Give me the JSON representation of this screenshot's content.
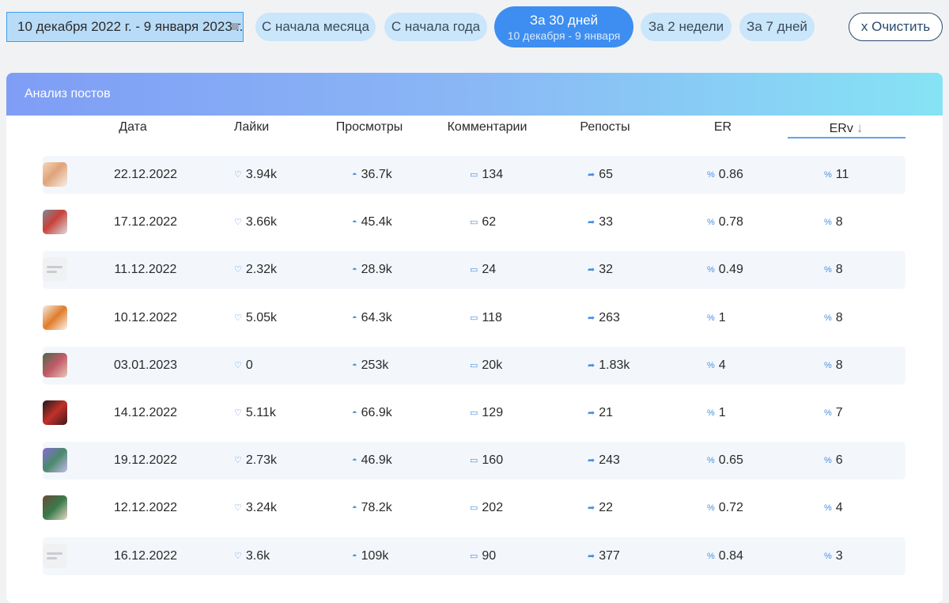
{
  "filters": {
    "date_range": "10 декабря 2022 г. - 9 января 2023 г.",
    "from_month_start": "С начала месяца",
    "from_year_start": "С начала года",
    "last_30_days": "За 30 дней",
    "last_30_days_range": "10 декабря - 9 января",
    "last_2_weeks": "За 2 недели",
    "last_7_days": "За 7 дней",
    "clear": "x Очистить"
  },
  "panel": {
    "title": "Анализ постов"
  },
  "columns": {
    "date": "Дата",
    "likes": "Лайки",
    "views": "Просмотры",
    "comments": "Комментарии",
    "reposts": "Репосты",
    "er": "ER",
    "erv": "ERv",
    "sort_indicator": "↓"
  },
  "icons": {
    "likes": "heart-icon",
    "views": "eye-icon",
    "comments": "comment-icon",
    "reposts": "share-icon",
    "er": "percent-icon",
    "erv": "percent-icon"
  },
  "colors": {
    "accent": "#3d8ef0",
    "pill": "#c9e6fb",
    "header_gradient_start": "#7f9df5",
    "header_gradient_end": "#86e3f5",
    "icon": "#4a8fe0"
  },
  "rows": [
    {
      "thumb": "photo",
      "date": "22.12.2022",
      "likes": "3.94k",
      "views": "36.7k",
      "comments": "134",
      "reposts": "65",
      "er": "0.86",
      "erv": "11"
    },
    {
      "thumb": "photo",
      "date": "17.12.2022",
      "likes": "3.66k",
      "views": "45.4k",
      "comments": "62",
      "reposts": "33",
      "er": "0.78",
      "erv": "8"
    },
    {
      "thumb": "placeholder",
      "date": "11.12.2022",
      "likes": "2.32k",
      "views": "28.9k",
      "comments": "24",
      "reposts": "32",
      "er": "0.49",
      "erv": "8"
    },
    {
      "thumb": "photo",
      "date": "10.12.2022",
      "likes": "5.05k",
      "views": "64.3k",
      "comments": "118",
      "reposts": "263",
      "er": "1",
      "erv": "8"
    },
    {
      "thumb": "photo",
      "date": "03.01.2023",
      "likes": "0",
      "views": "253k",
      "comments": "20k",
      "reposts": "1.83k",
      "er": "4",
      "erv": "8"
    },
    {
      "thumb": "photo",
      "date": "14.12.2022",
      "likes": "5.11k",
      "views": "66.9k",
      "comments": "129",
      "reposts": "21",
      "er": "1",
      "erv": "7"
    },
    {
      "thumb": "photo",
      "date": "19.12.2022",
      "likes": "2.73k",
      "views": "46.9k",
      "comments": "160",
      "reposts": "243",
      "er": "0.65",
      "erv": "6"
    },
    {
      "thumb": "photo",
      "date": "12.12.2022",
      "likes": "3.24k",
      "views": "78.2k",
      "comments": "202",
      "reposts": "22",
      "er": "0.72",
      "erv": "4"
    },
    {
      "thumb": "placeholder",
      "date": "16.12.2022",
      "likes": "3.6k",
      "views": "109k",
      "comments": "90",
      "reposts": "377",
      "er": "0.84",
      "erv": "3"
    }
  ]
}
